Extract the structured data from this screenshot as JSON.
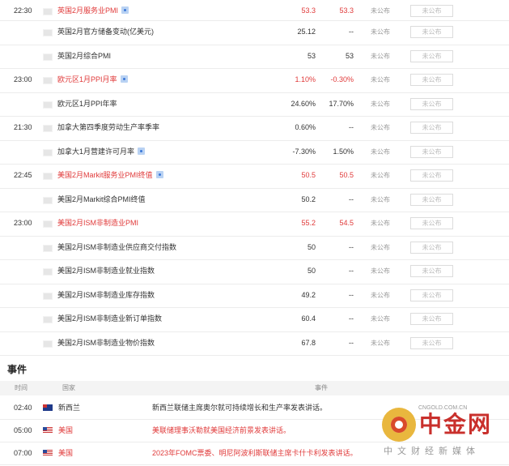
{
  "rows": [
    {
      "time": "22:30",
      "name": "英国2月服务业PMI",
      "red": true,
      "badge": true,
      "prev": "53.3",
      "fcst": "53.3",
      "prev_red": true,
      "fcst_red": true,
      "actual": "未公布",
      "actual_box": "未公布"
    },
    {
      "time": "",
      "name": "英国2月官方储备变动(亿美元)",
      "red": false,
      "badge": false,
      "prev": "25.12",
      "fcst": "--",
      "actual": "未公布",
      "actual_box": "未公布"
    },
    {
      "time": "",
      "name": "英国2月综合PMI",
      "red": false,
      "badge": false,
      "prev": "53",
      "fcst": "53",
      "actual": "未公布",
      "actual_box": "未公布"
    },
    {
      "time": "23:00",
      "name": "欧元区1月PPI月率",
      "red": true,
      "badge": true,
      "prev": "1.10%",
      "fcst": "-0.30%",
      "prev_red": true,
      "fcst_red": true,
      "actual": "未公布",
      "actual_box": "未公布"
    },
    {
      "time": "",
      "name": "欧元区1月PPI年率",
      "red": false,
      "badge": false,
      "prev": "24.60%",
      "fcst": "17.70%",
      "actual": "未公布",
      "actual_box": "未公布"
    },
    {
      "time": "21:30",
      "name": "加拿大第四季度劳动生产率季率",
      "red": false,
      "badge": false,
      "prev": "0.60%",
      "fcst": "--",
      "actual": "未公布",
      "actual_box": "未公布"
    },
    {
      "time": "",
      "name": "加拿大1月营建许可月率",
      "red": false,
      "badge": true,
      "prev": "-7.30%",
      "fcst": "1.50%",
      "actual": "未公布",
      "actual_box": "未公布"
    },
    {
      "time": "22:45",
      "name": "美国2月Markit服务业PMI终值",
      "red": true,
      "badge": true,
      "prev": "50.5",
      "fcst": "50.5",
      "prev_red": true,
      "fcst_red": true,
      "actual": "未公布",
      "actual_box": "未公布"
    },
    {
      "time": "",
      "name": "美国2月Markit综合PMI终值",
      "red": false,
      "badge": false,
      "prev": "50.2",
      "fcst": "--",
      "actual": "未公布",
      "actual_box": "未公布"
    },
    {
      "time": "23:00",
      "name": "美国2月ISM非制造业PMI",
      "red": true,
      "badge": false,
      "prev": "55.2",
      "fcst": "54.5",
      "prev_red": true,
      "fcst_red": true,
      "actual": "未公布",
      "actual_box": "未公布"
    },
    {
      "time": "",
      "name": "美国2月ISM非制造业供应商交付指数",
      "red": false,
      "badge": false,
      "prev": "50",
      "fcst": "--",
      "actual": "未公布",
      "actual_box": "未公布"
    },
    {
      "time": "",
      "name": "美国2月ISM非制造业就业指数",
      "red": false,
      "badge": false,
      "prev": "50",
      "fcst": "--",
      "actual": "未公布",
      "actual_box": "未公布"
    },
    {
      "time": "",
      "name": "美国2月ISM非制造业库存指数",
      "red": false,
      "badge": false,
      "prev": "49.2",
      "fcst": "--",
      "actual": "未公布",
      "actual_box": "未公布"
    },
    {
      "time": "",
      "name": "美国2月ISM非制造业新订单指数",
      "red": false,
      "badge": false,
      "prev": "60.4",
      "fcst": "--",
      "actual": "未公布",
      "actual_box": "未公布"
    },
    {
      "time": "",
      "name": "美国2月ISM非制造业物价指数",
      "red": false,
      "badge": false,
      "prev": "67.8",
      "fcst": "--",
      "actual": "未公布",
      "actual_box": "未公布"
    }
  ],
  "events": {
    "title": "事件",
    "headers": {
      "time": "时间",
      "country": "国家",
      "event": "事件"
    },
    "items": [
      {
        "time": "02:40",
        "flag": "nz",
        "country": "新西兰",
        "country_red": false,
        "text": "新西兰联储主席奥尔就可持续增长和生产率发表讲话。",
        "text_red": false
      },
      {
        "time": "05:00",
        "flag": "us",
        "country": "美国",
        "country_red": true,
        "text": "美联储理事沃勒就美国经济前景发表讲话。",
        "text_red": true
      },
      {
        "time": "07:00",
        "flag": "us",
        "country": "美国",
        "country_red": true,
        "text": "2023年FOMC票委、明尼阿波利斯联储主席卡什卡利发表讲话。",
        "text_red": true
      }
    ]
  },
  "logo": {
    "name": "中金网",
    "url": "CNGOLD.COM.CN",
    "sub": "中文财经新媒体"
  }
}
